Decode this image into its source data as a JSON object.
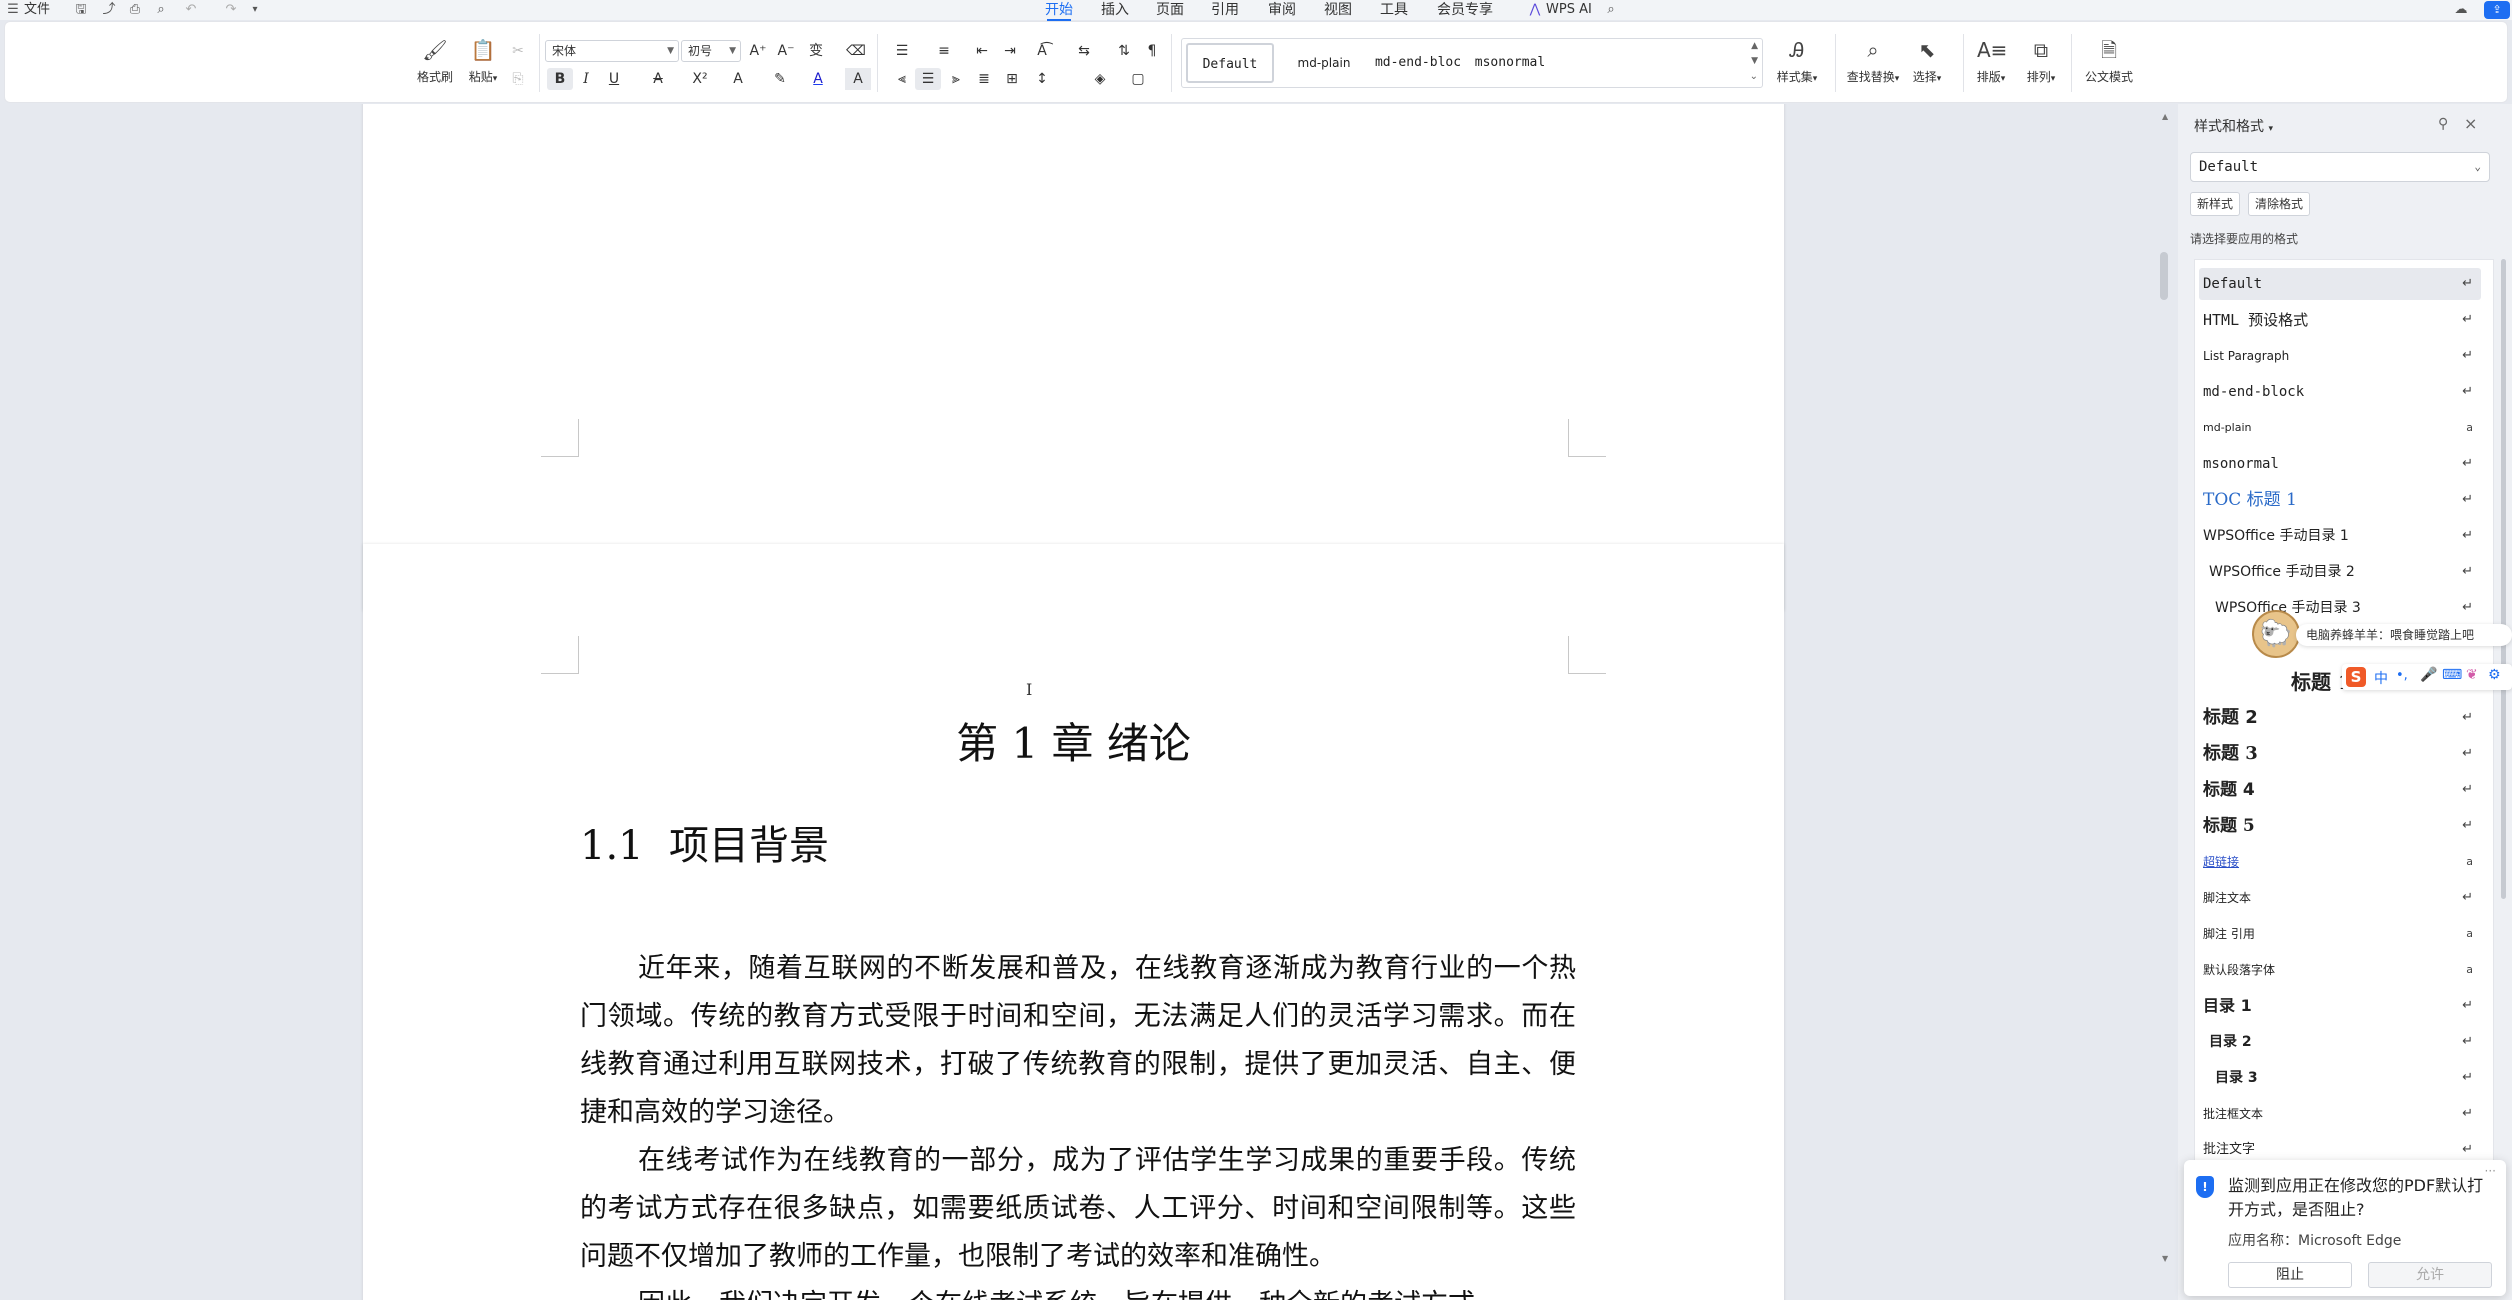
{
  "menubar": {
    "file_label": "文件",
    "tabs": [
      "开始",
      "插入",
      "页面",
      "引用",
      "审阅",
      "视图",
      "工具",
      "会员专享"
    ],
    "ai_label": "WPS AI"
  },
  "ribbon": {
    "format_painter": "格式刷",
    "paste": "粘贴",
    "font_name": "宋体",
    "font_size": "初号",
    "gallery": [
      "Default",
      "md-plain",
      "md-end-bloc",
      "msonormal"
    ],
    "style_set": "样式集",
    "find_replace": "查找替换",
    "select": "选择",
    "typeset": "排版",
    "arrange": "排列",
    "doc_mode": "公文模式"
  },
  "document": {
    "chapter_title": "第 1 章  绪论",
    "section_title": "1.1  项目背景",
    "paragraphs": [
      "近年来，随着互联网的不断发展和普及，在线教育逐渐成为教育行业的一个热门领域。传统的教育方式受限于时间和空间，无法满足人们的灵活学习需求。而在线教育通过利用互联网技术，打破了传统教育的限制，提供了更加灵活、自主、便捷和高效的学习途径。",
      "在线考试作为在线教育的一部分，成为了评估学生学习成果的重要手段。传统的考试方式存在很多缺点，如需要纸质试卷、人工评分、时间和空间限制等。这些问题不仅增加了教师的工作量，也限制了考试的效率和准确性。",
      "因此，我们决定开发一个在线考试系统，旨在提供一种全新的考试方式"
    ]
  },
  "styles_panel": {
    "title": "样式和格式",
    "current_style": "Default",
    "new_style": "新样式",
    "clear_format": "清除格式",
    "hint": "请选择要应用的格式",
    "items": [
      {
        "name": "Default",
        "mark": "↵"
      },
      {
        "name": "HTML 预设格式",
        "mark": "↵"
      },
      {
        "name": "List Paragraph",
        "mark": "↵"
      },
      {
        "name": "md-end-block",
        "mark": "↵"
      },
      {
        "name": "md-plain",
        "mark": "a"
      },
      {
        "name": "msonormal",
        "mark": "↵"
      },
      {
        "name": "TOC 标题 1",
        "mark": "↵"
      },
      {
        "name": "WPSOffice 手动目录 1",
        "mark": "↵"
      },
      {
        "name": "WPSOffice 手动目录 2",
        "mark": "↵"
      },
      {
        "name": "WPSOffice 手动目录 3",
        "mark": "↵"
      },
      {
        "name": "标题 1",
        "mark": "↵"
      },
      {
        "name": "标题 2",
        "mark": "↵"
      },
      {
        "name": "标题 3",
        "mark": "↵"
      },
      {
        "name": "标题 4",
        "mark": "↵"
      },
      {
        "name": "标题 5",
        "mark": "↵"
      },
      {
        "name": "超链接",
        "mark": "a"
      },
      {
        "name": "脚注文本",
        "mark": "↵"
      },
      {
        "name": "脚注 引用",
        "mark": "a"
      },
      {
        "name": "默认段落字体",
        "mark": "a"
      },
      {
        "name": "目录 1",
        "mark": "↵"
      },
      {
        "name": "目录 2",
        "mark": "↵"
      },
      {
        "name": "目录 3",
        "mark": "↵"
      },
      {
        "name": "批注框文本",
        "mark": "↵"
      },
      {
        "name": "批注文字",
        "mark": "↵"
      }
    ]
  },
  "ime": {
    "tip": "电脑养蜂羊羊：喂食睡觉踏上吧",
    "mode": "中"
  },
  "notification": {
    "message": "监测到应用正在修改您的PDF默认打开方式，是否阻止?",
    "app_label": "应用名称：Microsoft Edge",
    "block": "阻止",
    "allow": "允许"
  },
  "colors": {
    "accent": "#1d6ef2",
    "toc_blue": "#2a6ac8"
  }
}
